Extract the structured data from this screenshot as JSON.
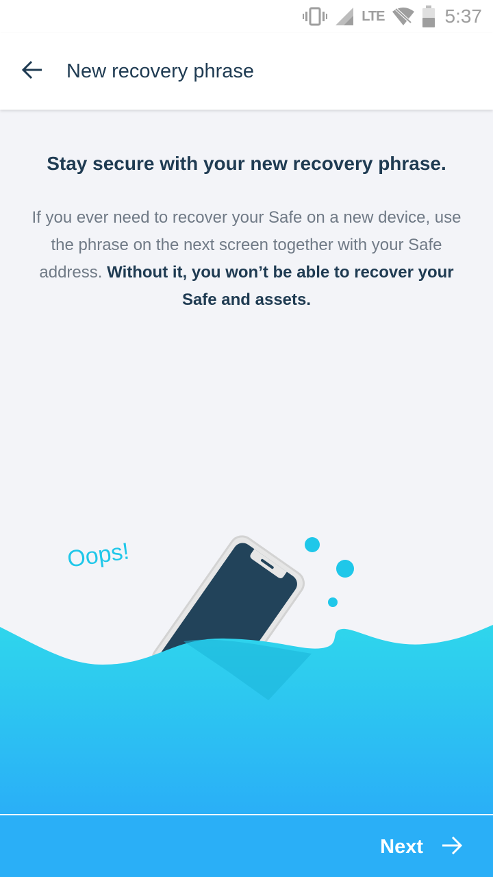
{
  "status_bar": {
    "network": "LTE",
    "time": "5:37",
    "icons": [
      "vibrate-icon",
      "signal-icon",
      "wifi-off-icon",
      "battery-icon"
    ]
  },
  "app_bar": {
    "title": "New recovery phrase",
    "back_icon": "arrow-back-icon"
  },
  "content": {
    "headline": "Stay secure with your new recovery phrase.",
    "body_regular": "If you ever need to recover your Safe on a new device, use the phrase on the next screen together with your Safe address.",
    "body_bold": "Without it, you won’t be able to recover your Safe and assets."
  },
  "illustration": {
    "caption": "Oops!"
  },
  "footer": {
    "next_label": "Next",
    "next_icon": "arrow-forward-icon"
  },
  "colors": {
    "accent": "#2aaff7",
    "water_light": "#2fd6ec",
    "text_dark": "#1f3b52",
    "text_muted": "#707a86",
    "phone_screen": "#22435a",
    "background": "#f3f4f8"
  }
}
